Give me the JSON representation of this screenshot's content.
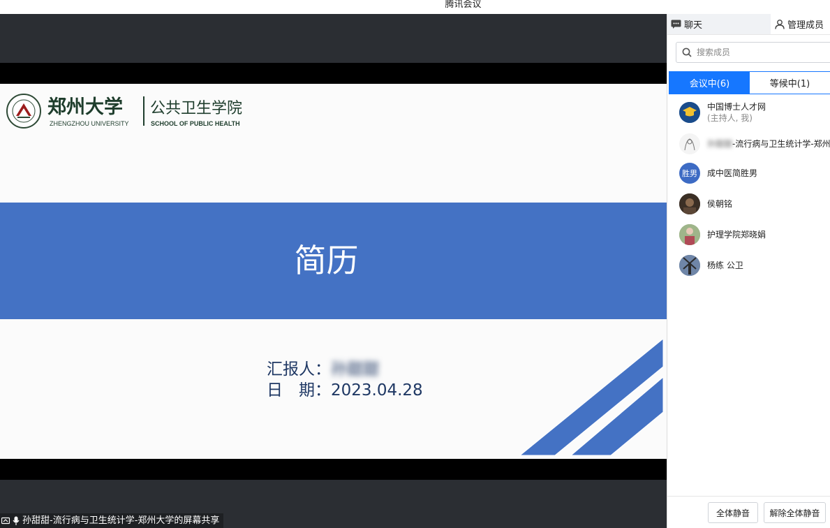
{
  "window": {
    "title": "腾讯会议"
  },
  "share": {
    "label": "孙甜甜-流行病与卫生统计学-郑州大学的屏幕共享"
  },
  "slide": {
    "logo": {
      "university_cn": "郑州大学",
      "university_en": "ZHENGZHOU UNIVERSITY",
      "school_cn": "公共卫生学院",
      "school_en": "SCHOOL OF PUBLIC HEALTH"
    },
    "title": "简历",
    "reporter_label": "汇报人：",
    "reporter_name": "孙甜甜",
    "date_label": "日　期：",
    "date_value": "2023.04.28",
    "colors": {
      "band": "#4472c4",
      "text": "#1f3864"
    }
  },
  "panel": {
    "tabs": [
      {
        "label": "聊天",
        "icon": "chat-icon"
      },
      {
        "label": "管理成员",
        "icon": "user-icon"
      }
    ],
    "search": {
      "placeholder": "搜索成员"
    },
    "member_tabs": [
      {
        "label": "会议中(6)",
        "active": true
      },
      {
        "label": "等候中(1)",
        "active": false
      }
    ],
    "members": [
      {
        "name": "中国博士人才网",
        "sub": "(主持人, 我)"
      },
      {
        "name": "-流行病与卫生统计学-郑州",
        "blurred_prefix": "孙甜甜"
      },
      {
        "name": "成中医简胜男",
        "avatar_text": "胜男"
      },
      {
        "name": "侯朝铭"
      },
      {
        "name": "护理学院郑晓娟"
      },
      {
        "name": "杨练 公卫"
      }
    ],
    "footer": {
      "mute_all": "全体静音",
      "unmute_all": "解除全体静音"
    },
    "accent": "#1677ff"
  }
}
